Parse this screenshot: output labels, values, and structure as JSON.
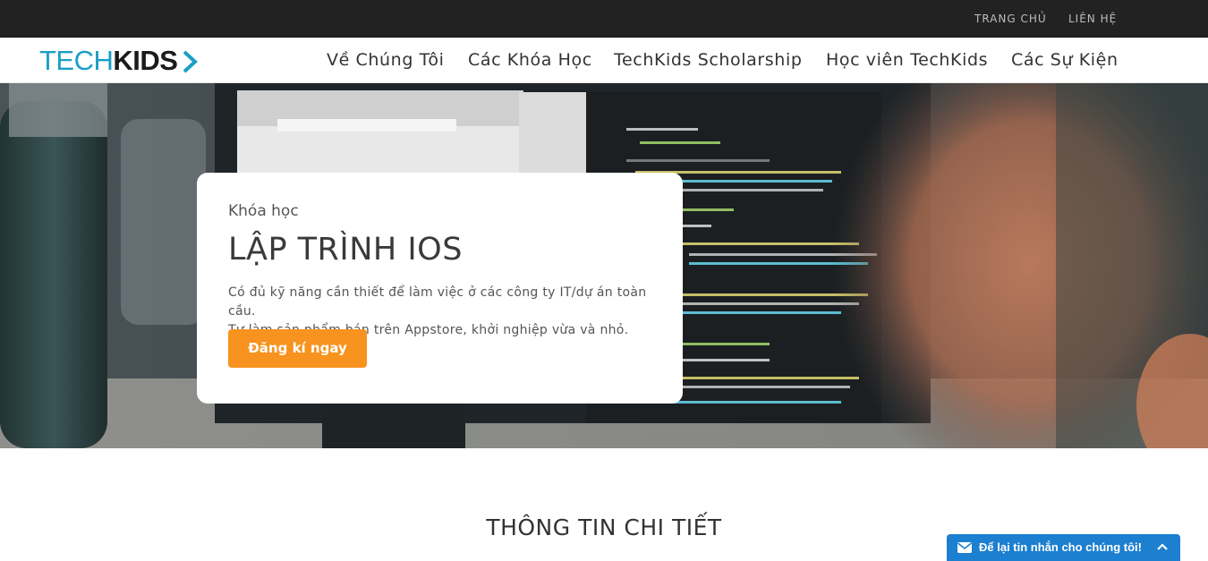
{
  "topbar": {
    "links": [
      {
        "label": "TRANG CHỦ"
      },
      {
        "label": "LIÊN HỆ"
      }
    ]
  },
  "logo": {
    "part1": "TECH",
    "part2": "KIDS",
    "icon": "chevron-right-icon",
    "brand_color": "#1a9fc6"
  },
  "nav": {
    "items": [
      {
        "label": "Về Chúng Tôi"
      },
      {
        "label": "Các Khóa Học"
      },
      {
        "label": "TechKids Scholarship"
      },
      {
        "label": "Học viên TechKids"
      },
      {
        "label": "Các Sự Kiện"
      }
    ]
  },
  "hero": {
    "kicker": "Khóa học",
    "title": "LẬP TRÌNH IOS",
    "description_line1": "Có đủ kỹ năng cần thiết để làm việc ở các công ty IT/dự án toàn cầu.",
    "description_line2": "Tự làm sản phẩm bán trên Appstore, khởi nghiệp vừa và nhỏ.",
    "cta_label": "Đăng kí ngay",
    "cta_color": "#f7931e"
  },
  "details": {
    "title": "THÔNG TIN CHI TIẾT"
  },
  "chat": {
    "label": "Để lại tin nhắn cho chúng tôi!",
    "icon": "envelope-icon",
    "toggle_icon": "chevron-up-icon",
    "color": "#1c7fcf"
  }
}
